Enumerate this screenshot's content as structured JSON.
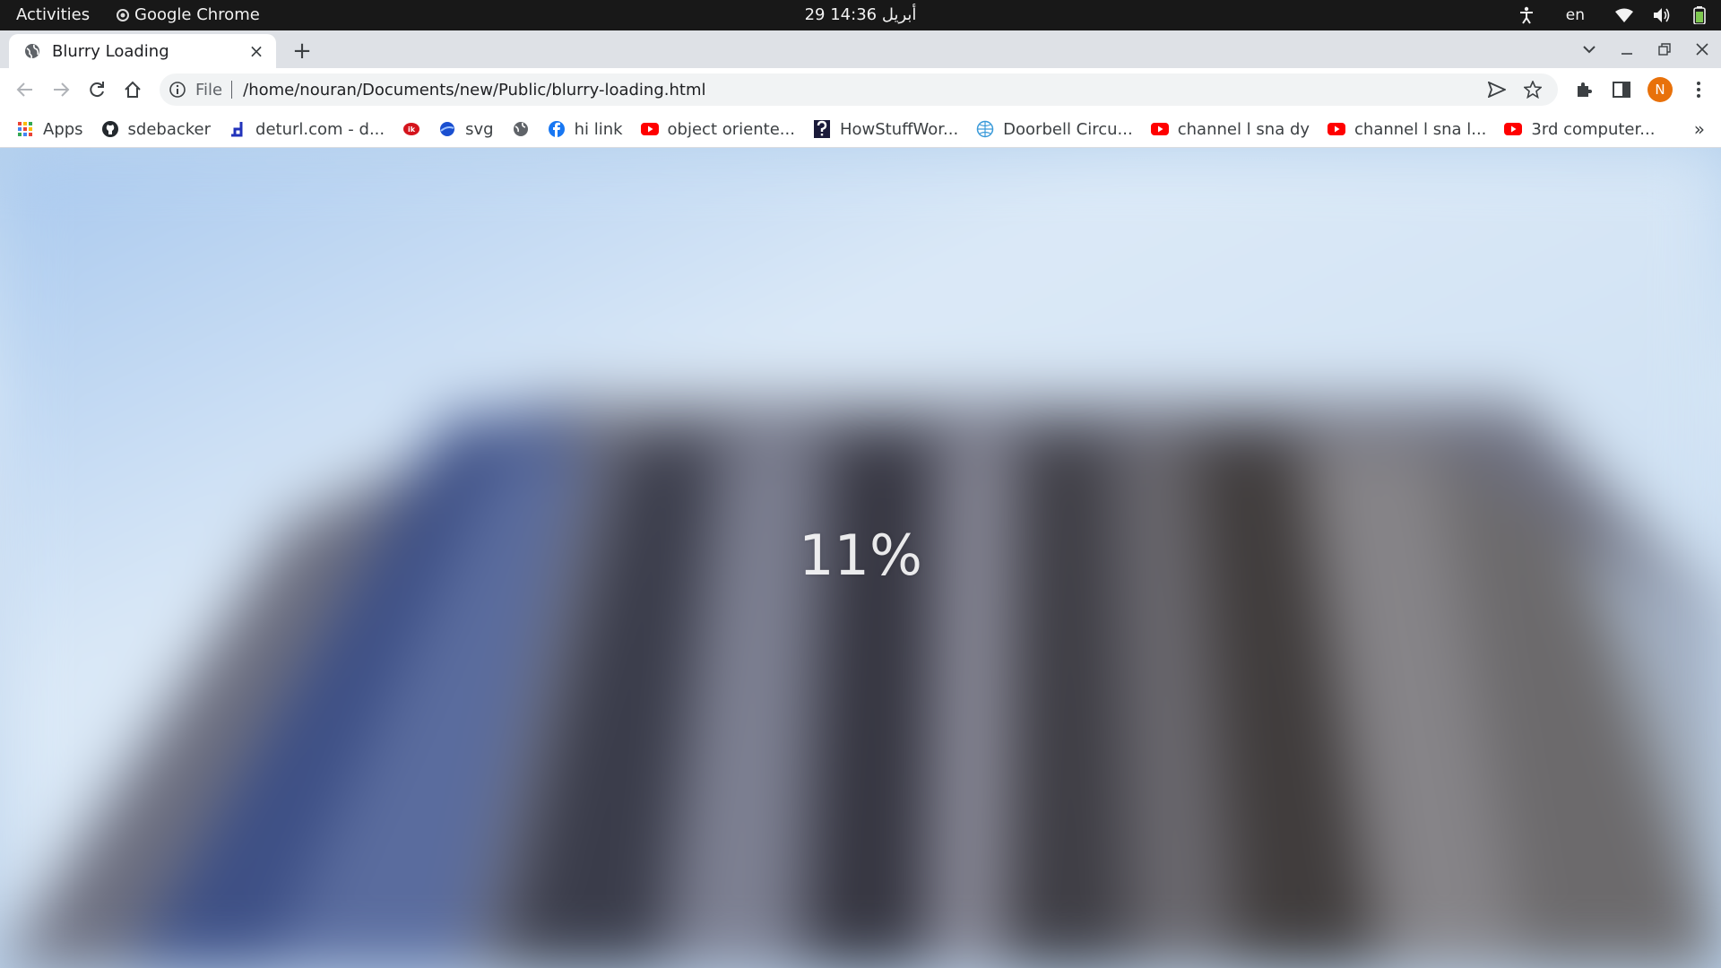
{
  "topbar": {
    "activities": "Activities",
    "app_name": "Google Chrome",
    "clock": "29 أبريل  14:36",
    "language": "en"
  },
  "tab": {
    "title": "Blurry Loading",
    "close": "×",
    "new_tab": "+"
  },
  "omnibox": {
    "scheme_chip": "File",
    "url": "/home/nouran/Documents/new/Public/blurry-loading.html"
  },
  "profile": {
    "initial": "N",
    "color": "#e8710a"
  },
  "bookmarks": {
    "items": [
      {
        "label": "Apps",
        "icon": "apps-grid-icon"
      },
      {
        "label": "sdebacker",
        "icon": "github-icon"
      },
      {
        "label": "deturl.com - d...",
        "icon": "deturl-icon"
      },
      {
        "label": "",
        "icon": "red-logo-icon"
      },
      {
        "label": "svg",
        "icon": "blue-sphere-icon"
      },
      {
        "label": "",
        "icon": "globe-icon"
      },
      {
        "label": "hi link",
        "icon": "facebook-icon"
      },
      {
        "label": "object oriente...",
        "icon": "youtube-icon"
      },
      {
        "label": "HowStuffWor...",
        "icon": "howstuffworks-icon"
      },
      {
        "label": "Doorbell Circu...",
        "icon": "globe-blue-icon"
      },
      {
        "label": "channel l sna dy",
        "icon": "youtube-icon"
      },
      {
        "label": "channel l sna l...",
        "icon": "youtube-icon"
      },
      {
        "label": "3rd computer...",
        "icon": "youtube-icon"
      }
    ],
    "overflow": "»"
  },
  "page": {
    "loading_text": "11%",
    "loading_progress": 11
  }
}
